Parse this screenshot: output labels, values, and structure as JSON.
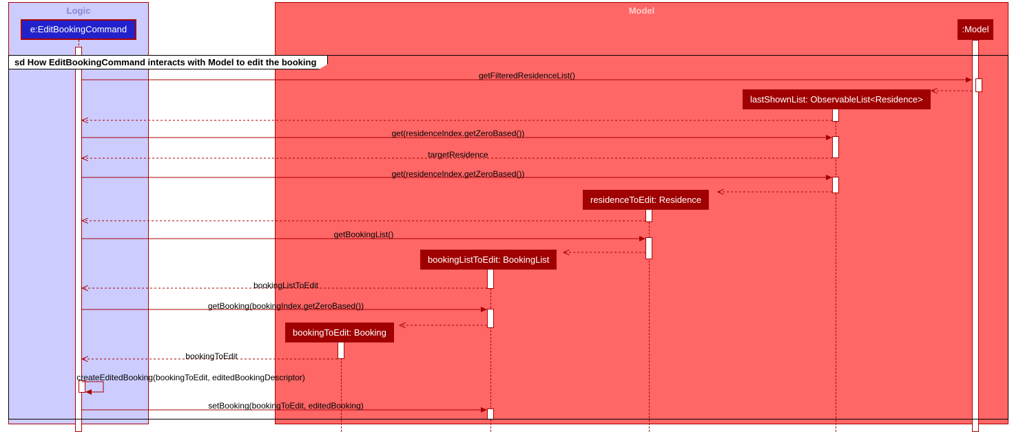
{
  "frame": {
    "title": "sd How EditBookingCommand interacts with Model to edit the booking"
  },
  "participants": {
    "logic_box": "Logic",
    "model_box": "Model",
    "edit_cmd": "e:EditBookingCommand",
    "model_head": ":Model"
  },
  "objects": {
    "lastShownList": "lastShownList: ObservableList<Residence>",
    "residenceToEdit": "residenceToEdit: Residence",
    "bookingListToEdit": "bookingListToEdit: BookingList",
    "bookingToEdit": "bookingToEdit: Booking"
  },
  "messages": {
    "m1": "getFilteredResidenceList()",
    "m2_return": "",
    "m3_return": "",
    "m4": "get(residenceIndex.getZeroBased())",
    "m5_return": "targetResidence",
    "m6": "get(residenceIndex.getZeroBased())",
    "m7_return": "",
    "m8_return": "",
    "m9": "getBookingList()",
    "m10_return": "",
    "m11_return": "bookingListToEdit",
    "m12": "getBooking(bookingIndex.getZeroBased())",
    "m13_return": "",
    "m14_return": "bookingToEdit",
    "m15": "createEditedBooking(bookingToEdit, editedBookingDescriptor)",
    "m16": "setBooking(bookingToEdit, editedBooking)"
  },
  "chart_data": {
    "type": "sequence_diagram",
    "participants": [
      {
        "name": "e:EditBookingCommand",
        "group": "Logic"
      },
      {
        "name": ":Model",
        "group": "Model"
      },
      {
        "name": "lastShownList: ObservableList<Residence>",
        "group": "Model",
        "created_by_msg": 1
      },
      {
        "name": "residenceToEdit: Residence",
        "group": "Model",
        "created_by_msg": 6
      },
      {
        "name": "bookingListToEdit: BookingList",
        "group": "Model",
        "created_by_msg": 9
      },
      {
        "name": "bookingToEdit: Booking",
        "group": "Model",
        "created_by_msg": 12
      }
    ],
    "messages": [
      {
        "from": "e:EditBookingCommand",
        "to": ":Model",
        "label": "getFilteredResidenceList()",
        "type": "sync"
      },
      {
        "from": ":Model",
        "to": "lastShownList",
        "label": "",
        "type": "create"
      },
      {
        "from": "lastShownList",
        "to": "e:EditBookingCommand",
        "label": "",
        "type": "return"
      },
      {
        "from": "e:EditBookingCommand",
        "to": "lastShownList",
        "label": "get(residenceIndex.getZeroBased())",
        "type": "sync"
      },
      {
        "from": "lastShownList",
        "to": "e:EditBookingCommand",
        "label": "targetResidence",
        "type": "return"
      },
      {
        "from": "e:EditBookingCommand",
        "to": "lastShownList",
        "label": "get(residenceIndex.getZeroBased())",
        "type": "sync"
      },
      {
        "from": "lastShownList",
        "to": "residenceToEdit",
        "label": "",
        "type": "create"
      },
      {
        "from": "residenceToEdit",
        "to": "e:EditBookingCommand",
        "label": "",
        "type": "return"
      },
      {
        "from": "e:EditBookingCommand",
        "to": "residenceToEdit",
        "label": "getBookingList()",
        "type": "sync"
      },
      {
        "from": "residenceToEdit",
        "to": "bookingListToEdit",
        "label": "",
        "type": "create"
      },
      {
        "from": "bookingListToEdit",
        "to": "e:EditBookingCommand",
        "label": "bookingListToEdit",
        "type": "return"
      },
      {
        "from": "e:EditBookingCommand",
        "to": "bookingListToEdit",
        "label": "getBooking(bookingIndex.getZeroBased())",
        "type": "sync"
      },
      {
        "from": "bookingListToEdit",
        "to": "bookingToEdit",
        "label": "",
        "type": "create"
      },
      {
        "from": "bookingToEdit",
        "to": "e:EditBookingCommand",
        "label": "bookingToEdit",
        "type": "return"
      },
      {
        "from": "e:EditBookingCommand",
        "to": "e:EditBookingCommand",
        "label": "createEditedBooking(bookingToEdit, editedBookingDescriptor)",
        "type": "self"
      },
      {
        "from": "e:EditBookingCommand",
        "to": "bookingListToEdit",
        "label": "setBooking(bookingToEdit, editedBooking)",
        "type": "sync"
      }
    ]
  }
}
